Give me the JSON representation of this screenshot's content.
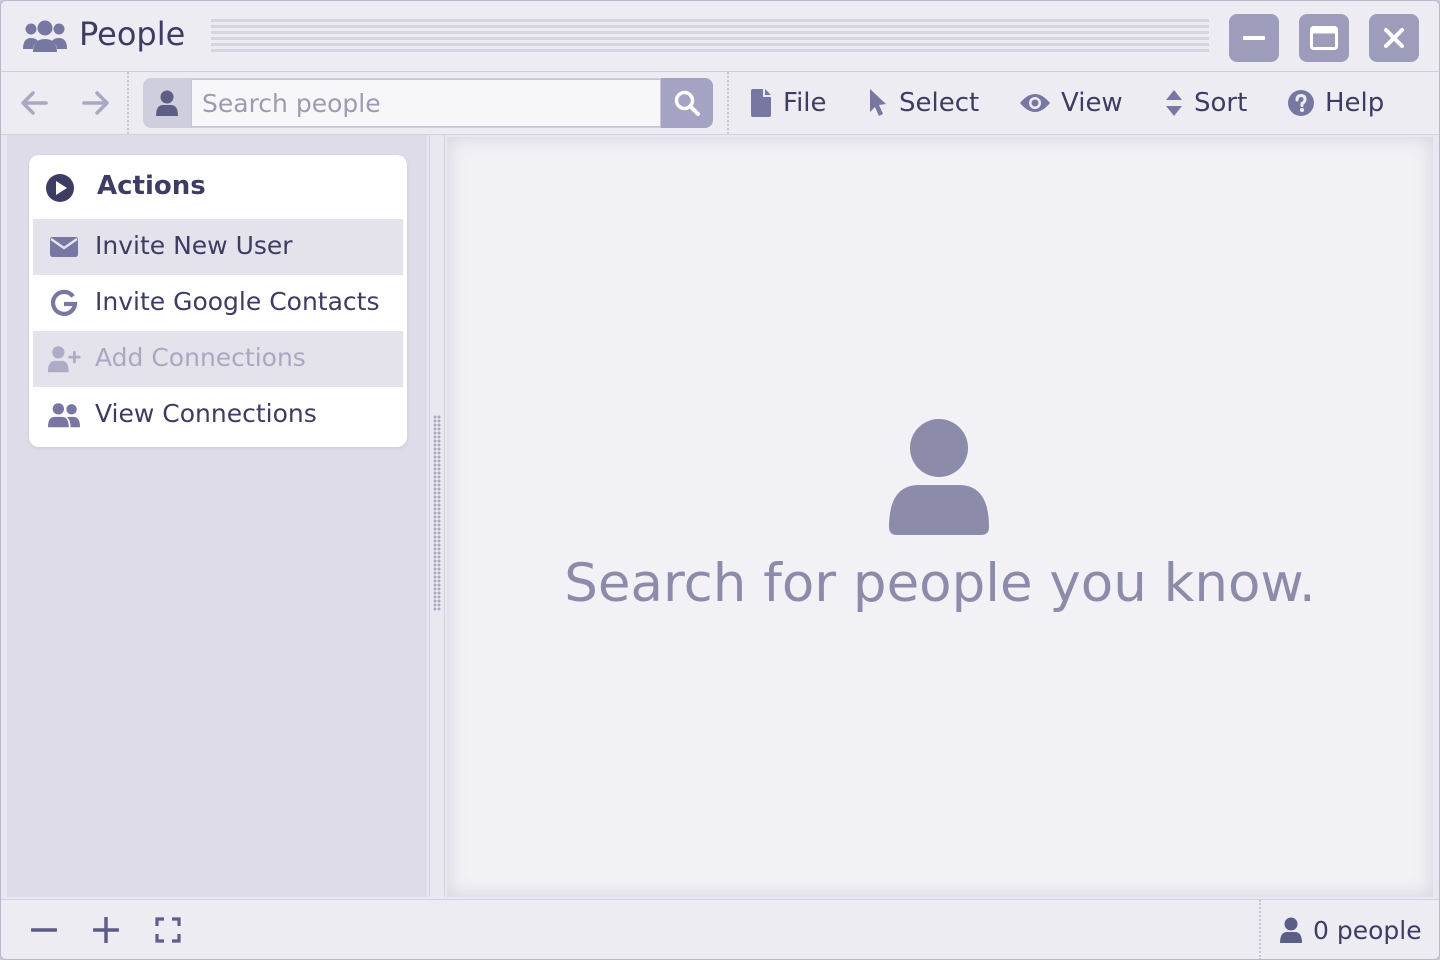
{
  "titlebar": {
    "title": "People",
    "app_icon": "users-icon",
    "controls": [
      "minimize-icon",
      "maximize-icon",
      "close-icon"
    ]
  },
  "toolbar": {
    "back_icon": "arrow-left-icon",
    "forward_icon": "arrow-right-icon",
    "search": {
      "placeholder": "Search people",
      "value": ""
    },
    "menus": [
      {
        "label": "File",
        "icon": "file-icon"
      },
      {
        "label": "Select",
        "icon": "pointer-icon"
      },
      {
        "label": "View",
        "icon": "eye-icon"
      },
      {
        "label": "Sort",
        "icon": "sort-icon"
      },
      {
        "label": "Help",
        "icon": "help-icon"
      }
    ]
  },
  "sidebar": {
    "actions_title": "Actions",
    "actions": [
      {
        "label": "Invite New User",
        "icon": "envelope-icon",
        "enabled": true
      },
      {
        "label": "Invite Google Contacts",
        "icon": "google-icon",
        "enabled": true
      },
      {
        "label": "Add Connections",
        "icon": "user-plus-icon",
        "enabled": false
      },
      {
        "label": "View Connections",
        "icon": "users-icon",
        "enabled": true
      }
    ]
  },
  "main": {
    "empty_icon": "person-icon",
    "empty_message": "Search for people you know."
  },
  "statusbar": {
    "zoom_out_icon": "minus-icon",
    "zoom_in_icon": "plus-icon",
    "fit_icon": "fullscreen-icon",
    "count_label": "0 people"
  },
  "colors": {
    "text": "#3d3c63",
    "icon": "#8c8baa",
    "window_button": "#9d9cbb",
    "disabled_text": "#a9a8c0"
  }
}
